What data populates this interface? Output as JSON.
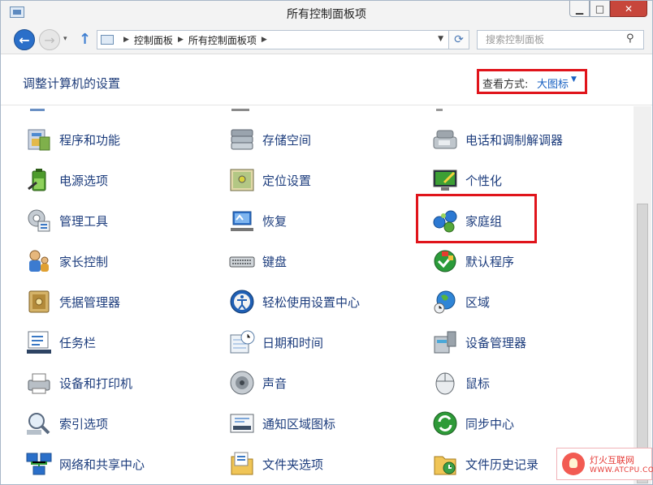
{
  "window": {
    "title": "所有控制面板项",
    "minimize": "▁",
    "maximize": "□",
    "close": "✕"
  },
  "nav": {
    "back": "←",
    "forward": "→",
    "dropdown": "▾",
    "up": "↑",
    "breadcrumb": [
      "控制面板",
      "所有控制面板项"
    ],
    "refresh": "⟳",
    "search_placeholder": "搜索控制面板",
    "search_icon": "⚲"
  },
  "header": {
    "title": "调整计算机的设置",
    "view_label": "查看方式:",
    "view_value": "大图标",
    "view_caret": "▼"
  },
  "items": [
    {
      "label": "程序和功能",
      "icon": "programs-features-icon"
    },
    {
      "label": "存储空间",
      "icon": "storage-spaces-icon"
    },
    {
      "label": "电话和调制解调器",
      "icon": "phone-modem-icon"
    },
    {
      "label": "电源选项",
      "icon": "power-options-icon"
    },
    {
      "label": "定位设置",
      "icon": "location-settings-icon"
    },
    {
      "label": "个性化",
      "icon": "personalization-icon"
    },
    {
      "label": "管理工具",
      "icon": "admin-tools-icon"
    },
    {
      "label": "恢复",
      "icon": "recovery-icon"
    },
    {
      "label": "家庭组",
      "icon": "homegroup-icon"
    },
    {
      "label": "家长控制",
      "icon": "parental-controls-icon"
    },
    {
      "label": "键盘",
      "icon": "keyboard-icon"
    },
    {
      "label": "默认程序",
      "icon": "default-programs-icon"
    },
    {
      "label": "凭据管理器",
      "icon": "credential-manager-icon"
    },
    {
      "label": "轻松使用设置中心",
      "icon": "ease-of-access-icon"
    },
    {
      "label": "区域",
      "icon": "region-icon"
    },
    {
      "label": "任务栏",
      "icon": "taskbar-icon"
    },
    {
      "label": "日期和时间",
      "icon": "date-time-icon"
    },
    {
      "label": "设备管理器",
      "icon": "device-manager-icon"
    },
    {
      "label": "设备和打印机",
      "icon": "devices-printers-icon"
    },
    {
      "label": "声音",
      "icon": "sound-icon"
    },
    {
      "label": "鼠标",
      "icon": "mouse-icon"
    },
    {
      "label": "索引选项",
      "icon": "indexing-options-icon"
    },
    {
      "label": "通知区域图标",
      "icon": "notification-area-icon"
    },
    {
      "label": "同步中心",
      "icon": "sync-center-icon"
    },
    {
      "label": "网络和共享中心",
      "icon": "network-sharing-icon"
    },
    {
      "label": "文件夹选项",
      "icon": "folder-options-icon"
    },
    {
      "label": "文件历史记录",
      "icon": "file-history-icon"
    }
  ],
  "watermark": {
    "title": "灯火互联网",
    "sub": "WWW.ATCPU.COM"
  },
  "colors": {
    "accent": "#1760c2",
    "label": "#1d3d7d",
    "highlight": "#e0141b",
    "close": "#c7463b"
  }
}
